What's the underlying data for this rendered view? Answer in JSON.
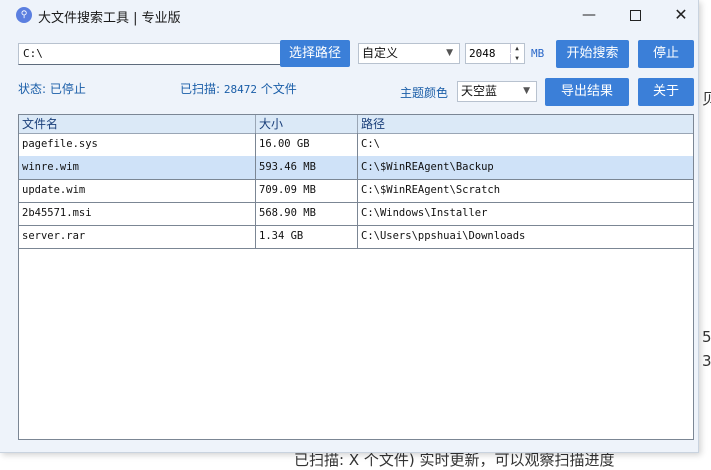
{
  "window": {
    "title": "大文件搜索工具 | 专业版"
  },
  "toolbar": {
    "path_value": "C:\\",
    "choose_path_label": "选择路径",
    "size_mode": "自定义",
    "size_value": "2048",
    "size_unit": "MB",
    "start_label": "开始搜索",
    "stop_label": "停止",
    "export_label": "导出结果",
    "about_label": "关于"
  },
  "status": {
    "state": "状态: 已停止",
    "scanned_prefix": "已扫描: ",
    "scanned_count": "28472",
    "scanned_suffix": " 个文件"
  },
  "theme": {
    "label": "主题颜色",
    "value": "天空蓝"
  },
  "table": {
    "headers": [
      "文件名",
      "大小",
      "路径"
    ],
    "rows": [
      {
        "name": "pagefile.sys",
        "size": "16.00 GB",
        "path": "C:\\"
      },
      {
        "name": "winre.wim",
        "size": "593.46 MB",
        "path": "C:\\$WinREAgent\\Backup"
      },
      {
        "name": "update.wim",
        "size": "709.09 MB",
        "path": "C:\\$WinREAgent\\Scratch"
      },
      {
        "name": "2b45571.msi",
        "size": "568.90 MB",
        "path": "C:\\Windows\\Installer"
      },
      {
        "name": "server.rar",
        "size": "1.34 GB",
        "path": "C:\\Users\\ppshuai\\Downloads"
      }
    ]
  },
  "background_text": {
    "line1": "已扫描: X 个文件) 实时更新，可以观察扫描进度"
  },
  "colors": {
    "accent": "#3b7fd8",
    "window_bg": "#eef3fa",
    "selected_row": "#cfe2f8"
  }
}
